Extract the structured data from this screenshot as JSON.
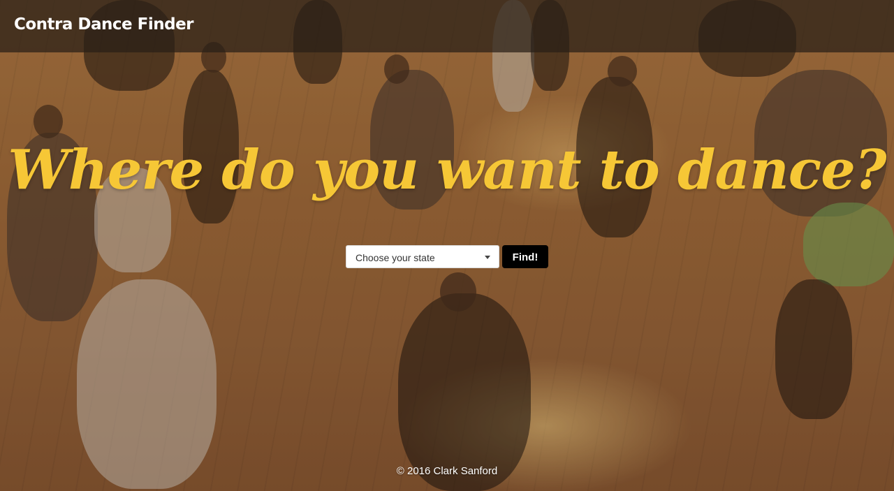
{
  "navbar": {
    "brand": "Contra Dance Finder"
  },
  "hero": {
    "headline": "Where do you want to dance?",
    "background_image": "contra-dancers-photo",
    "headline_color": "#f6c736"
  },
  "search": {
    "state_select_value": "Choose your state",
    "find_label": "Find!",
    "button_color": "#000000"
  },
  "footer": {
    "copyright": "© 2016 Clark Sanford"
  }
}
